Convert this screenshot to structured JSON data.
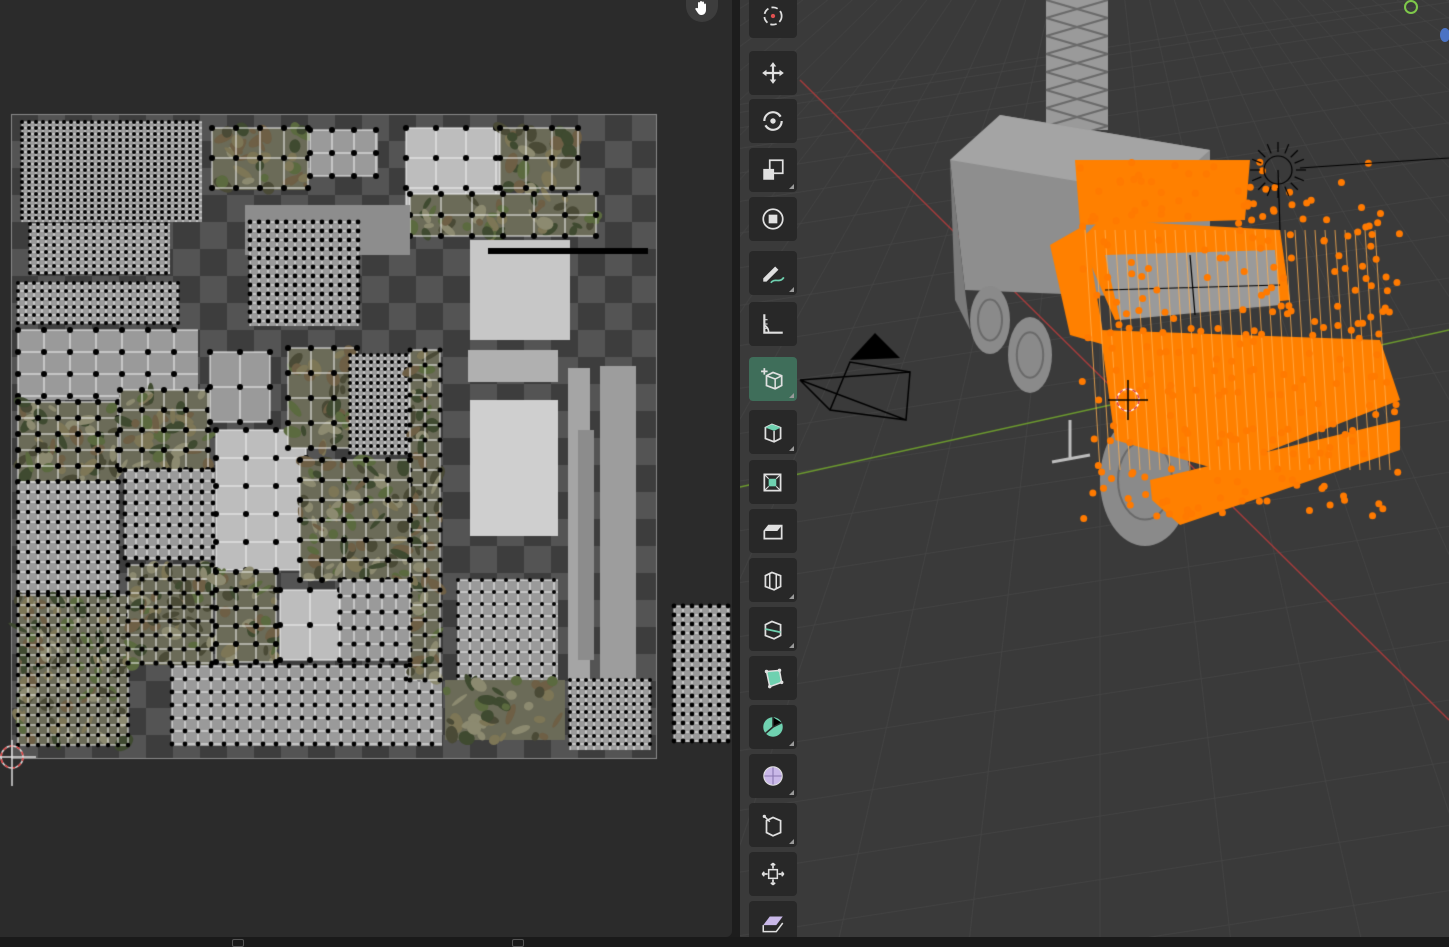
{
  "uv_editor": {
    "tool": "pan-view",
    "checker_colors": [
      "#3d3d3d",
      "#545454"
    ]
  },
  "viewport": {
    "grid_color": "#454545",
    "x_axis_color": "#a83c3c",
    "y_axis_color": "#6c9a2e",
    "selection_color": "#ff8000",
    "object": "truck"
  },
  "toolbar": {
    "tools": [
      {
        "name": "cursor-tool",
        "icon": "crosshair-icon",
        "active": false
      },
      {
        "name": "move-tool",
        "icon": "move-arrows-icon",
        "active": false
      },
      {
        "name": "rotate-tool",
        "icon": "rotate-icon",
        "active": false
      },
      {
        "name": "scale-tool",
        "icon": "scale-icon",
        "active": false
      },
      {
        "name": "transform-tool",
        "icon": "transform-icon",
        "active": false
      },
      {
        "name": "annotate-tool",
        "icon": "pencil-icon",
        "active": false
      },
      {
        "name": "measure-tool",
        "icon": "ruler-icon",
        "active": false
      },
      {
        "name": "add-cube-tool",
        "icon": "add-cube-icon",
        "active": true
      },
      {
        "name": "extrude-tool",
        "icon": "extrude-icon",
        "active": false
      },
      {
        "name": "inset-tool",
        "icon": "inset-icon",
        "active": false
      },
      {
        "name": "bevel-tool",
        "icon": "bevel-icon",
        "active": false
      },
      {
        "name": "loop-cut-tool",
        "icon": "loop-cut-icon",
        "active": false
      },
      {
        "name": "knife-tool",
        "icon": "knife-icon",
        "active": false
      },
      {
        "name": "poly-build-tool",
        "icon": "poly-build-icon",
        "active": false
      },
      {
        "name": "spin-tool",
        "icon": "spin-icon",
        "active": false
      },
      {
        "name": "smooth-tool",
        "icon": "smooth-icon",
        "active": false
      },
      {
        "name": "edge-slide-tool",
        "icon": "edge-slide-icon",
        "active": false
      },
      {
        "name": "shrink-fatten-tool",
        "icon": "shrink-fatten-icon",
        "active": false
      },
      {
        "name": "shear-tool",
        "icon": "shear-icon",
        "active": false
      }
    ]
  }
}
